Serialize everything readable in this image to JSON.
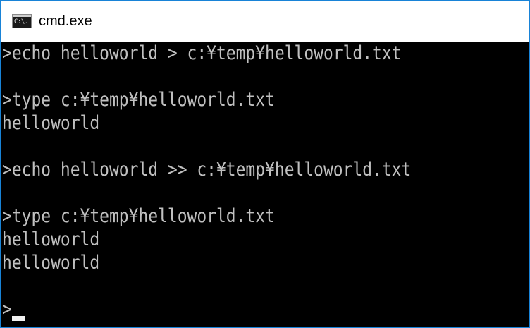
{
  "window": {
    "title": "cmd.exe",
    "icon": "cmd-console-icon",
    "icon_text": "C:\\."
  },
  "console": {
    "lines": [
      ">echo helloworld > c:¥temp¥helloworld.txt",
      "",
      ">type c:¥temp¥helloworld.txt",
      "helloworld",
      "",
      ">echo helloworld >> c:¥temp¥helloworld.txt",
      "",
      ">type c:¥temp¥helloworld.txt",
      "helloworld",
      "helloworld",
      "",
      ">"
    ]
  },
  "colors": {
    "background": "#000000",
    "text": "#c0c0c0",
    "titlebar": "#ffffff",
    "border": "#1883d7"
  }
}
